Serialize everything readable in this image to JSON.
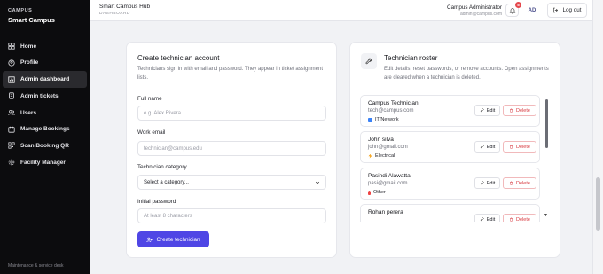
{
  "sidebar": {
    "kicker": "CAMPUS",
    "name": "Smart Campus",
    "items": [
      {
        "label": "Home",
        "icon": "grid-icon"
      },
      {
        "label": "Profile",
        "icon": "user-circle-icon"
      },
      {
        "label": "Admin dashboard",
        "icon": "chart-icon",
        "active": true
      },
      {
        "label": "Admin tickets",
        "icon": "ticket-icon"
      },
      {
        "label": "Users",
        "icon": "users-icon"
      },
      {
        "label": "Manage Bookings",
        "icon": "calendar-icon"
      },
      {
        "label": "Scan Booking QR",
        "icon": "qr-icon"
      },
      {
        "label": "Facility Manager",
        "icon": "gear-icon"
      }
    ],
    "footer": "Maintenance & service desk"
  },
  "header": {
    "title": "Smart Campus Hub",
    "subtitle": "DASHBOARD",
    "user_name": "Campus Administrator",
    "user_email": "admin@campus.com",
    "notification_count": "5",
    "avatar": "AD",
    "logout_label": "Log out"
  },
  "create": {
    "title": "Create technician account",
    "description": "Technicians sign in with email and password. They appear in ticket assignment lists.",
    "full_name_label": "Full name",
    "full_name_placeholder": "e.g. Alex Rivera",
    "email_label": "Work email",
    "email_placeholder": "technician@campus.edu",
    "category_label": "Technician category",
    "category_value": "Select a category...",
    "password_label": "Initial password",
    "password_placeholder": "At least 8 characters",
    "submit_label": "Create technician"
  },
  "roster": {
    "title": "Technician roster",
    "description": "Edit details, reset passwords, or remove accounts. Open assignments are cleared when a technician is deleted.",
    "edit_label": "Edit",
    "delete_label": "Delete",
    "technicians": [
      {
        "name": "Campus Technician",
        "email": "tech@campus.com",
        "category": "IT/Network",
        "cat_color": "#3b82f6"
      },
      {
        "name": "John silva",
        "email": "john@gmail.com",
        "category": "Electrical",
        "cat_color": "#f59e0b"
      },
      {
        "name": "Pasindi Alawatta",
        "email": "pasi@gmail.com",
        "category": "Other",
        "cat_color": "#ef4444"
      },
      {
        "name": "Rohan perera",
        "email": "",
        "category": "",
        "cat_color": "#888"
      }
    ]
  }
}
